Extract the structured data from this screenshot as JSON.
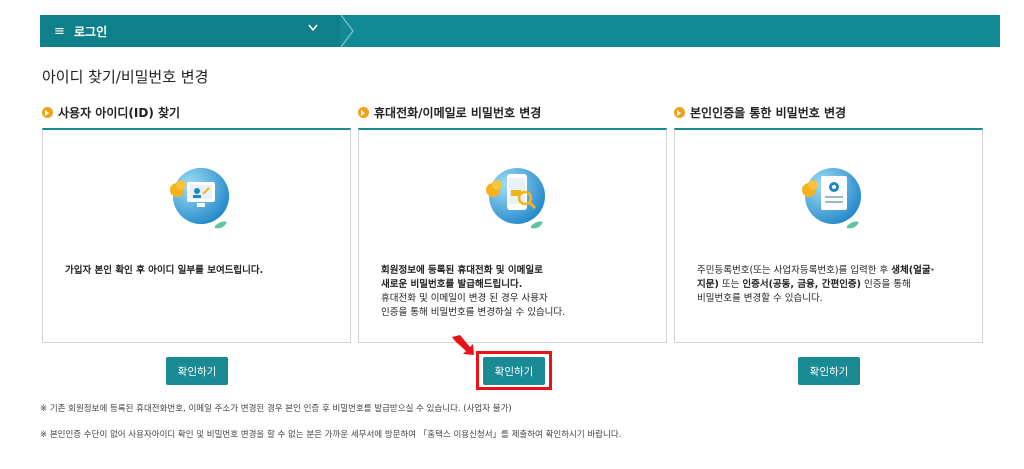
{
  "nav": {
    "menu_icon": "≡",
    "menu_label": "로그인",
    "dropdown_icon": "chevron-down"
  },
  "page_title": "아이디 찾기/비밀번호 변경",
  "sections": [
    {
      "title": "사용자 아이디(ID) 찾기",
      "desc_lines": [
        "가입자 본인 확인 후 아이디 일부를 보여드립니다."
      ],
      "button": "확인하기"
    },
    {
      "title": "휴대전화/이메일로 비밀번호 변경",
      "desc_bold": [
        "회원정보에 등록된 휴대전화 및 이메일로",
        "새로운 비밀번호를 발급해드립니다."
      ],
      "desc_lines": [
        "휴대전화 및 이메일이 변경 된 경우 사용자",
        "인증을 통해 비밀번호를 변경하실 수 있습니다."
      ],
      "button": "확인하기"
    },
    {
      "title": "본인인증을 통한 비밀번호 변경",
      "desc_lines": [
        "주민등록번호(또는 사업자등록번호)를 입력한 후 ",
        "생체(얼굴·",
        "지문)",
        " 또는 ",
        "인증서(공동, 금융, 간편인증)",
        " 인증을 통해",
        "비밀번호를 변경할 수 있습니다."
      ],
      "button": "확인하기"
    }
  ],
  "notes": [
    "※ 기존 회원정보에 등록된 휴대전화번호, 이메일 주소가 변경된 경우 본인 인증 후 비밀번호를 발급받으실 수 있습니다. (사업자 불가)",
    "※ 본인인증 수단이 없어 사용자아이디 확인 및 비밀번호 변경을 할 수 없는 분은 가까운 세무서에 방문하여 「홈택스 이용신청서」를 제출하여 확인하시기 바랍니다."
  ],
  "colors": {
    "teal": "#128a95",
    "orange": "#f1a21a",
    "highlight": "#e8141a"
  }
}
